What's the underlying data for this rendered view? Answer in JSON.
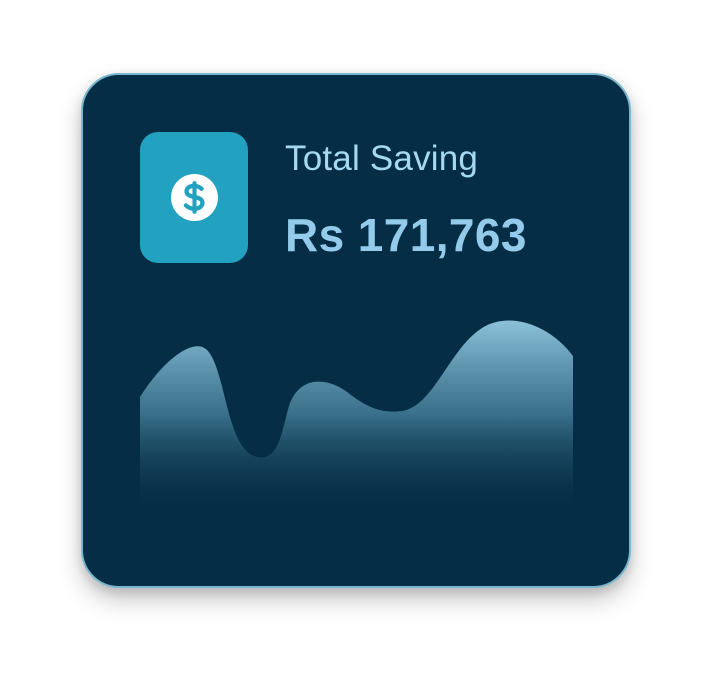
{
  "card": {
    "title": "Total Saving",
    "amount": "Rs 171,763",
    "icon": "dollar-icon"
  },
  "colors": {
    "background": "#ffffff",
    "card_background": "#052e46",
    "card_border": "#79b6cf",
    "icon_tile": "#22a1c0",
    "title_text": "#a6d9f1",
    "amount_text": "#94cbea",
    "area_top": "#8fc4dd",
    "area_bottom": "#052e46"
  }
}
